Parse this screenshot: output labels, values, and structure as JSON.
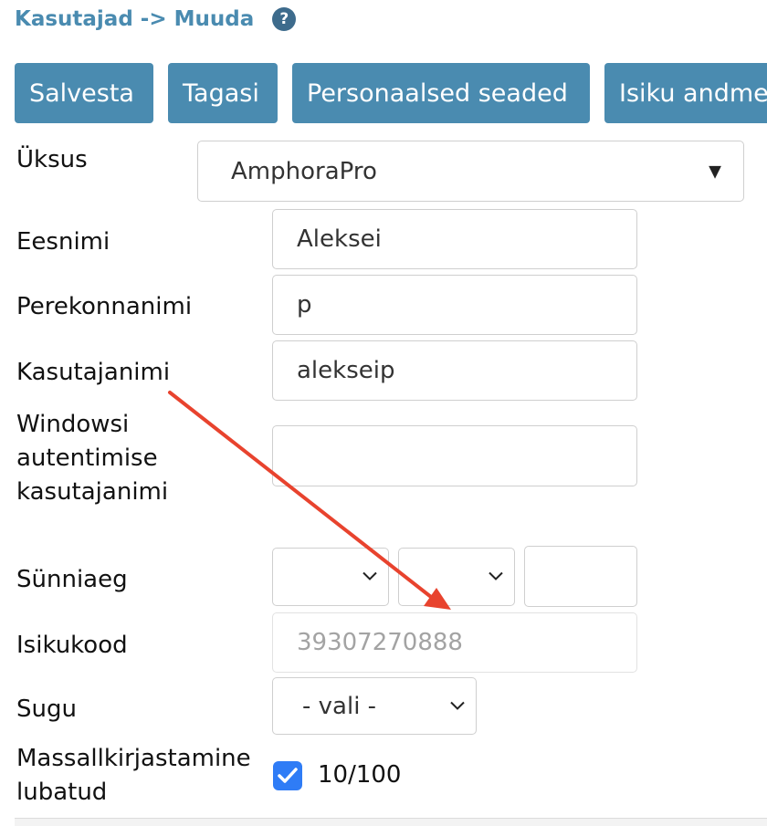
{
  "header": {
    "title": "Kasutajad -> Muuda",
    "help_icon": "?"
  },
  "toolbar": {
    "save": "Salvesta",
    "back": "Tagasi",
    "personal_settings": "Personaalsed seaded",
    "person_data": "Isiku andme"
  },
  "form": {
    "unit": {
      "label": "Üksus",
      "value": "AmphoraPro"
    },
    "first_name": {
      "label": "Eesnimi",
      "value": "Aleksei"
    },
    "last_name": {
      "label": "Perekonnanimi",
      "value": "p"
    },
    "username": {
      "label": "Kasutajanimi",
      "value": "alekseip"
    },
    "windows_username": {
      "label_lines": [
        "Windowsi",
        "autentimise",
        "kasutajanimi"
      ],
      "value": ""
    },
    "birth_date": {
      "label": "Sünniaeg",
      "day": "",
      "month": "",
      "year": ""
    },
    "id_code": {
      "label": "Isikukood",
      "value": "39307270888"
    },
    "gender": {
      "label": "Sugu",
      "value": "- vali -"
    },
    "mass_signing": {
      "label_lines": [
        "Massallkirjastamine",
        "lubatud"
      ],
      "checked": true,
      "limit": "10/100"
    }
  },
  "colors": {
    "accent": "#4a8bb0",
    "help_icon_bg": "#3d6b8c",
    "checkbox": "#2f7cf6",
    "annotation_arrow": "#e8432e"
  },
  "icons": {
    "help": "help-icon",
    "dropdown": "triangle-down-icon",
    "select": "chevron-down-icon",
    "check": "check-icon",
    "annotation": "arrow-icon"
  }
}
